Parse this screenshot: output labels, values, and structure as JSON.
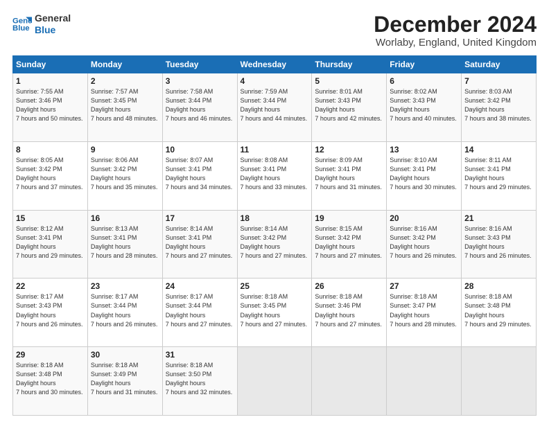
{
  "logo": {
    "line1": "General",
    "line2": "Blue"
  },
  "title": "December 2024",
  "subtitle": "Worlaby, England, United Kingdom",
  "days_of_week": [
    "Sunday",
    "Monday",
    "Tuesday",
    "Wednesday",
    "Thursday",
    "Friday",
    "Saturday"
  ],
  "weeks": [
    [
      {
        "day": 1,
        "sunrise": "7:55 AM",
        "sunset": "3:46 PM",
        "daylight": "7 hours and 50 minutes."
      },
      {
        "day": 2,
        "sunrise": "7:57 AM",
        "sunset": "3:45 PM",
        "daylight": "7 hours and 48 minutes."
      },
      {
        "day": 3,
        "sunrise": "7:58 AM",
        "sunset": "3:44 PM",
        "daylight": "7 hours and 46 minutes."
      },
      {
        "day": 4,
        "sunrise": "7:59 AM",
        "sunset": "3:44 PM",
        "daylight": "7 hours and 44 minutes."
      },
      {
        "day": 5,
        "sunrise": "8:01 AM",
        "sunset": "3:43 PM",
        "daylight": "7 hours and 42 minutes."
      },
      {
        "day": 6,
        "sunrise": "8:02 AM",
        "sunset": "3:43 PM",
        "daylight": "7 hours and 40 minutes."
      },
      {
        "day": 7,
        "sunrise": "8:03 AM",
        "sunset": "3:42 PM",
        "daylight": "7 hours and 38 minutes."
      }
    ],
    [
      {
        "day": 8,
        "sunrise": "8:05 AM",
        "sunset": "3:42 PM",
        "daylight": "7 hours and 37 minutes."
      },
      {
        "day": 9,
        "sunrise": "8:06 AM",
        "sunset": "3:42 PM",
        "daylight": "7 hours and 35 minutes."
      },
      {
        "day": 10,
        "sunrise": "8:07 AM",
        "sunset": "3:41 PM",
        "daylight": "7 hours and 34 minutes."
      },
      {
        "day": 11,
        "sunrise": "8:08 AM",
        "sunset": "3:41 PM",
        "daylight": "7 hours and 33 minutes."
      },
      {
        "day": 12,
        "sunrise": "8:09 AM",
        "sunset": "3:41 PM",
        "daylight": "7 hours and 31 minutes."
      },
      {
        "day": 13,
        "sunrise": "8:10 AM",
        "sunset": "3:41 PM",
        "daylight": "7 hours and 30 minutes."
      },
      {
        "day": 14,
        "sunrise": "8:11 AM",
        "sunset": "3:41 PM",
        "daylight": "7 hours and 29 minutes."
      }
    ],
    [
      {
        "day": 15,
        "sunrise": "8:12 AM",
        "sunset": "3:41 PM",
        "daylight": "7 hours and 29 minutes."
      },
      {
        "day": 16,
        "sunrise": "8:13 AM",
        "sunset": "3:41 PM",
        "daylight": "7 hours and 28 minutes."
      },
      {
        "day": 17,
        "sunrise": "8:14 AM",
        "sunset": "3:41 PM",
        "daylight": "7 hours and 27 minutes."
      },
      {
        "day": 18,
        "sunrise": "8:14 AM",
        "sunset": "3:42 PM",
        "daylight": "7 hours and 27 minutes."
      },
      {
        "day": 19,
        "sunrise": "8:15 AM",
        "sunset": "3:42 PM",
        "daylight": "7 hours and 27 minutes."
      },
      {
        "day": 20,
        "sunrise": "8:16 AM",
        "sunset": "3:42 PM",
        "daylight": "7 hours and 26 minutes."
      },
      {
        "day": 21,
        "sunrise": "8:16 AM",
        "sunset": "3:43 PM",
        "daylight": "7 hours and 26 minutes."
      }
    ],
    [
      {
        "day": 22,
        "sunrise": "8:17 AM",
        "sunset": "3:43 PM",
        "daylight": "7 hours and 26 minutes."
      },
      {
        "day": 23,
        "sunrise": "8:17 AM",
        "sunset": "3:44 PM",
        "daylight": "7 hours and 26 minutes."
      },
      {
        "day": 24,
        "sunrise": "8:17 AM",
        "sunset": "3:44 PM",
        "daylight": "7 hours and 27 minutes."
      },
      {
        "day": 25,
        "sunrise": "8:18 AM",
        "sunset": "3:45 PM",
        "daylight": "7 hours and 27 minutes."
      },
      {
        "day": 26,
        "sunrise": "8:18 AM",
        "sunset": "3:46 PM",
        "daylight": "7 hours and 27 minutes."
      },
      {
        "day": 27,
        "sunrise": "8:18 AM",
        "sunset": "3:47 PM",
        "daylight": "7 hours and 28 minutes."
      },
      {
        "day": 28,
        "sunrise": "8:18 AM",
        "sunset": "3:48 PM",
        "daylight": "7 hours and 29 minutes."
      }
    ],
    [
      {
        "day": 29,
        "sunrise": "8:18 AM",
        "sunset": "3:48 PM",
        "daylight": "7 hours and 30 minutes."
      },
      {
        "day": 30,
        "sunrise": "8:18 AM",
        "sunset": "3:49 PM",
        "daylight": "7 hours and 31 minutes."
      },
      {
        "day": 31,
        "sunrise": "8:18 AM",
        "sunset": "3:50 PM",
        "daylight": "7 hours and 32 minutes."
      },
      null,
      null,
      null,
      null
    ]
  ]
}
